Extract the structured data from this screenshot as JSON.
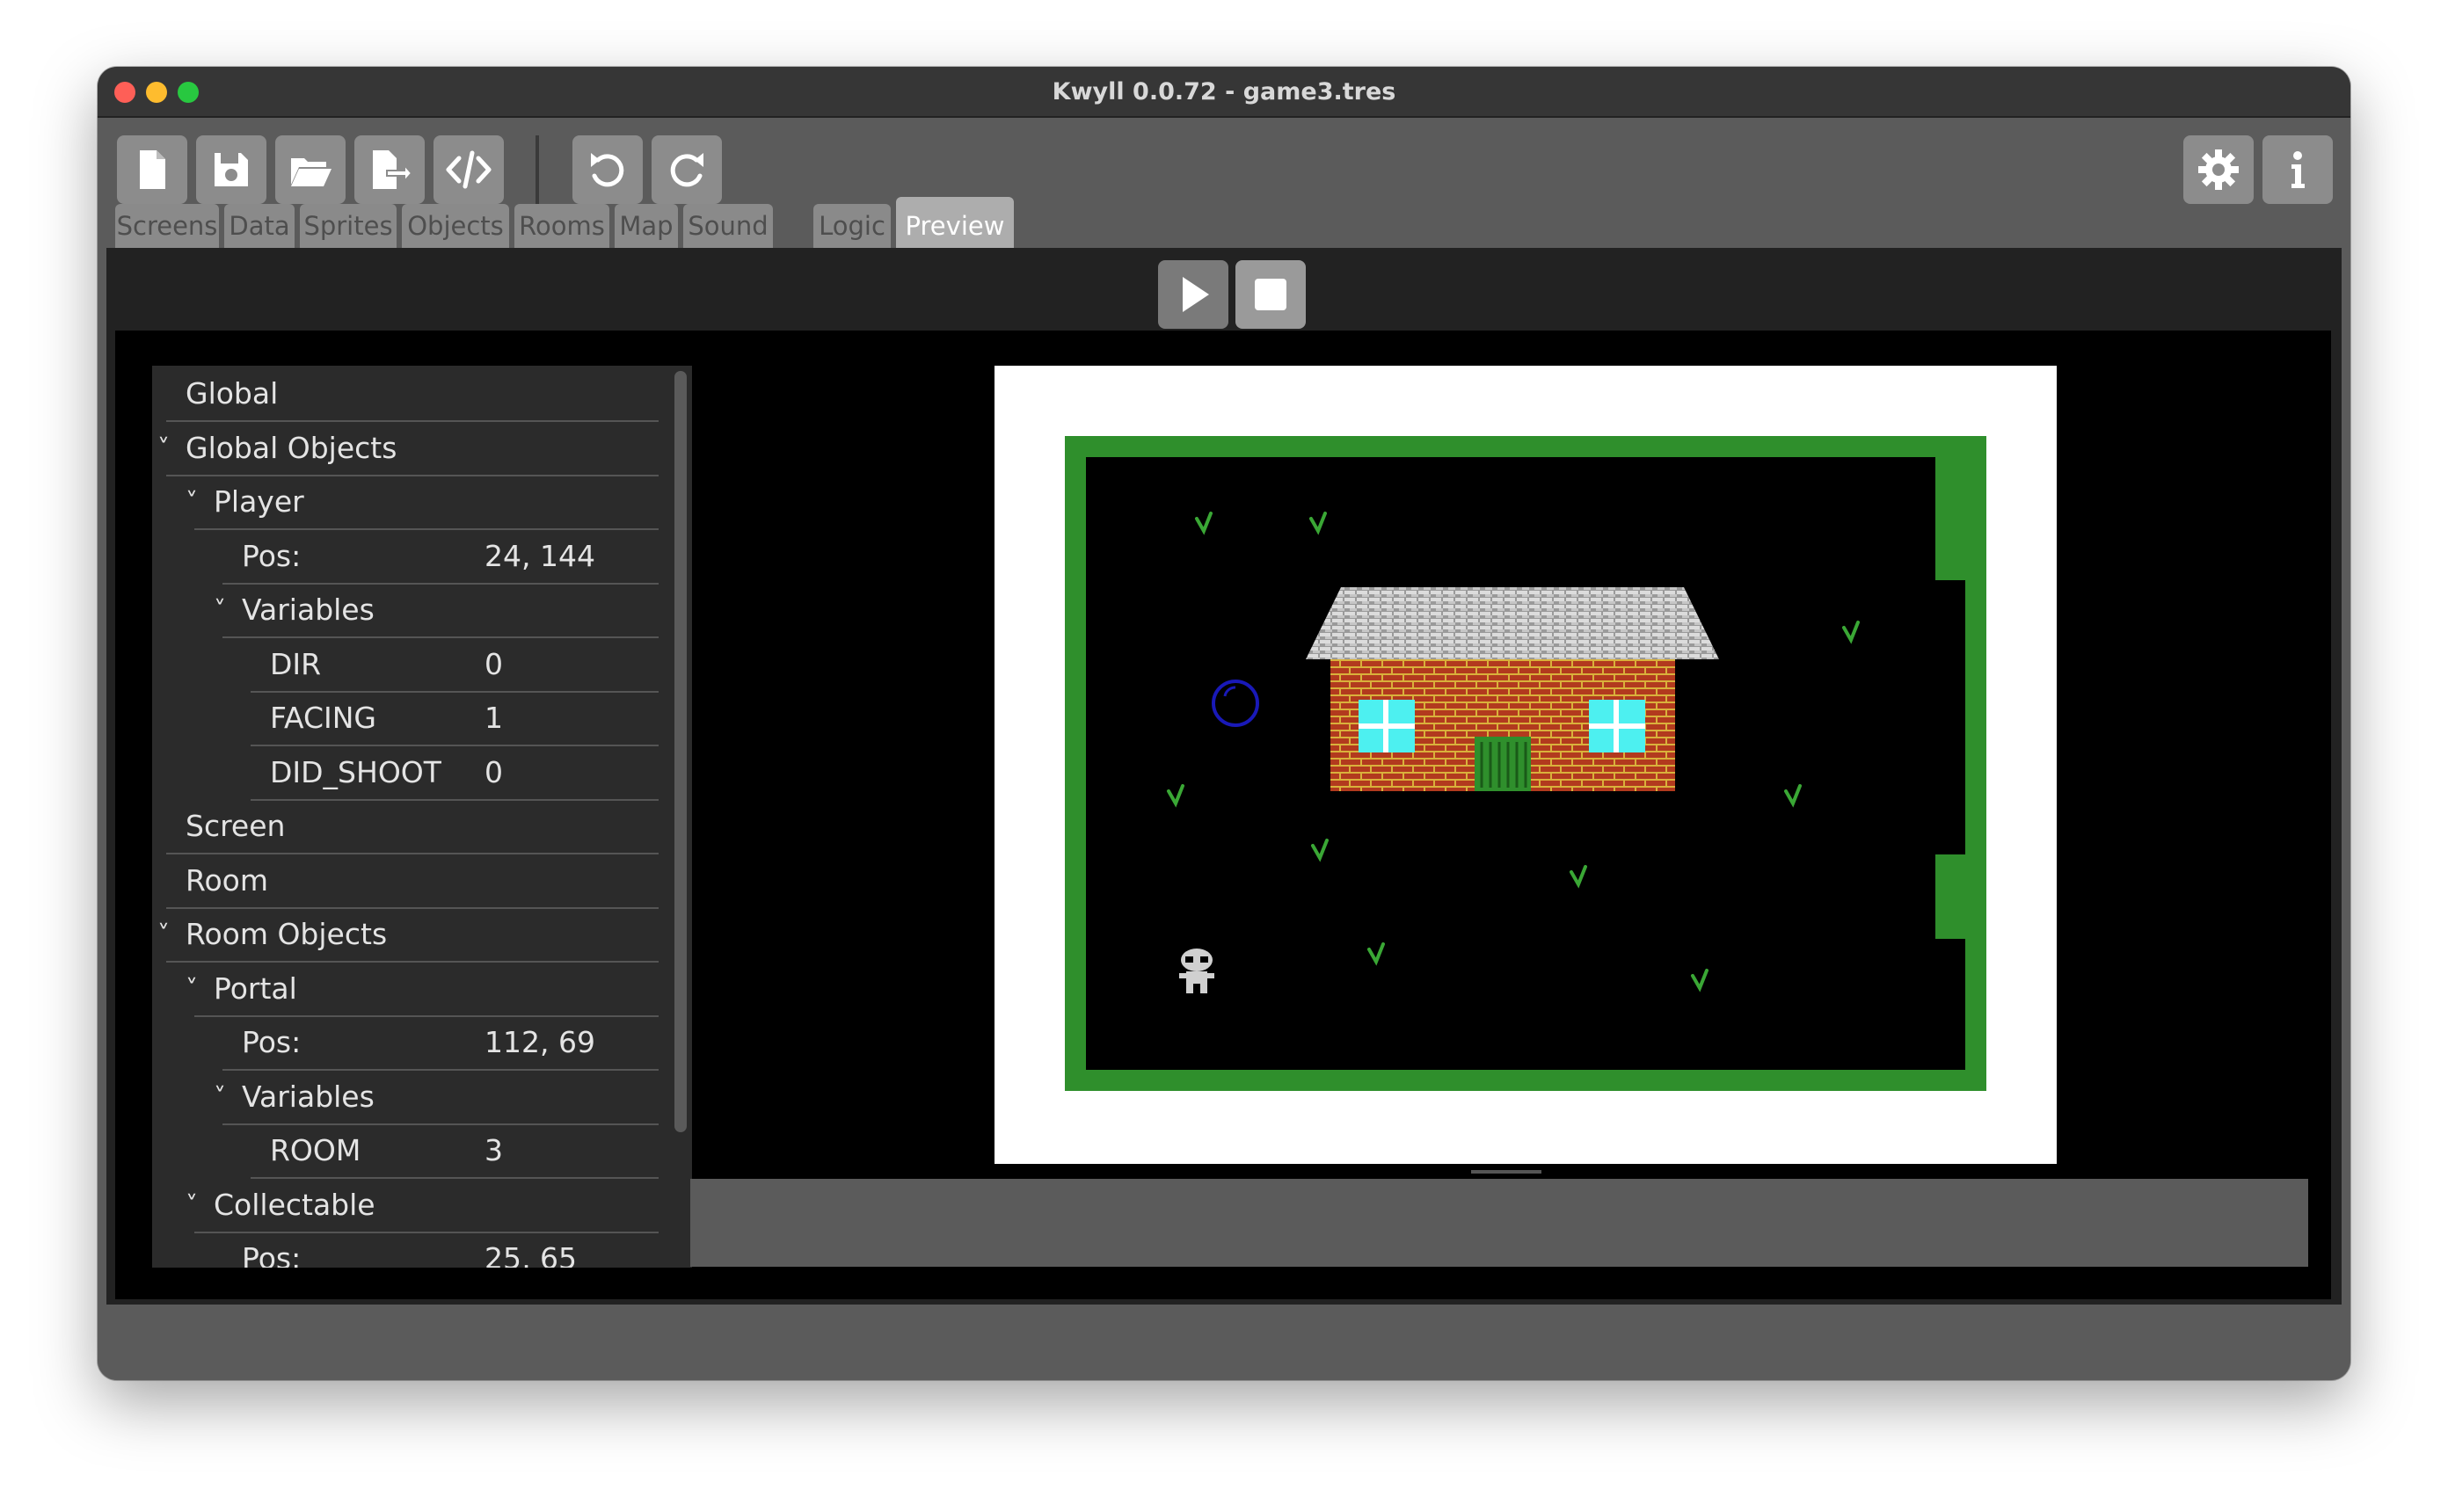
{
  "window": {
    "title": "Kwyll 0.0.72 - game3.tres"
  },
  "toolbar": {
    "buttons": [
      {
        "name": "new-file",
        "icon": "new-file-icon"
      },
      {
        "name": "save",
        "icon": "save-icon"
      },
      {
        "name": "open",
        "icon": "open-folder-icon"
      },
      {
        "name": "export",
        "icon": "export-icon"
      },
      {
        "name": "code",
        "icon": "code-icon"
      },
      {
        "name": "undo",
        "icon": "undo-icon"
      },
      {
        "name": "redo",
        "icon": "redo-icon"
      },
      {
        "name": "settings",
        "icon": "gear-icon"
      },
      {
        "name": "info",
        "icon": "info-icon"
      }
    ]
  },
  "tabs": [
    "Screens",
    "Data",
    "Sprites",
    "Objects",
    "Rooms",
    "Map",
    "Sound",
    "Logic",
    "Preview"
  ],
  "active_tab": "Preview",
  "preview_controls": {
    "play_icon": "play-icon",
    "stop_icon": "stop-icon"
  },
  "inspector": {
    "rows": [
      {
        "label": "Global",
        "value": "",
        "expanded": null
      },
      {
        "label": "Global Objects",
        "value": "",
        "expanded": true
      },
      {
        "label": "Player",
        "value": "",
        "expanded": true
      },
      {
        "label": "Pos:",
        "value": "24, 144",
        "expanded": null
      },
      {
        "label": "Variables",
        "value": "",
        "expanded": true
      },
      {
        "label": "DIR",
        "value": "0",
        "expanded": null
      },
      {
        "label": "FACING",
        "value": "1",
        "expanded": null
      },
      {
        "label": "DID_SHOOT",
        "value": "0",
        "expanded": null
      },
      {
        "label": "Screen",
        "value": "",
        "expanded": null
      },
      {
        "label": "Room",
        "value": "",
        "expanded": null
      },
      {
        "label": "Room Objects",
        "value": "",
        "expanded": true
      },
      {
        "label": "Portal",
        "value": "",
        "expanded": true
      },
      {
        "label": "Pos:",
        "value": "112, 69",
        "expanded": null
      },
      {
        "label": "Variables",
        "value": "",
        "expanded": true
      },
      {
        "label": "ROOM",
        "value": "3",
        "expanded": null
      },
      {
        "label": "Collectable",
        "value": "",
        "expanded": true
      },
      {
        "label": "Pos:",
        "value": "25, 65",
        "expanded": null
      }
    ]
  },
  "colors": {
    "accent_tab": "#adadad",
    "hedge_green": "#2f8f2c",
    "brick": "#b23a1e",
    "mortar": "#d9b13b",
    "window_cyan": "#4df0f0",
    "roof_grey": "#c9c9c9",
    "portal_blue": "#1919b8"
  }
}
